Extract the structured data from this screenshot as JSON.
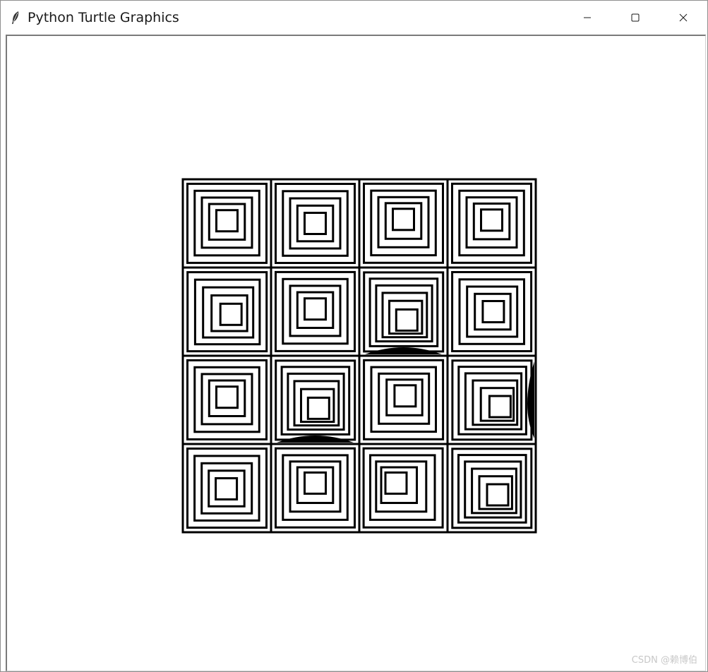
{
  "window": {
    "title": "Python Turtle Graphics",
    "app_icon": "feather-icon",
    "controls": {
      "minimize": "minimize-icon",
      "maximize": "maximize-icon",
      "close": "close-icon"
    }
  },
  "canvas": {
    "background": "#ffffff",
    "stroke_color": "#000000",
    "grid_rows": 4,
    "grid_cols": 4,
    "cells": [
      {
        "rings": 5,
        "dx": 0.0,
        "dy": -0.08,
        "fill_edge": ""
      },
      {
        "rings": 5,
        "dx": 0.0,
        "dy": 0.0,
        "fill_edge": ""
      },
      {
        "rings": 5,
        "dx": 0.0,
        "dy": -0.12,
        "fill_edge": ""
      },
      {
        "rings": 5,
        "dx": 0.0,
        "dy": -0.1,
        "fill_edge": ""
      },
      {
        "rings": 5,
        "dx": 0.12,
        "dy": 0.08,
        "fill_edge": ""
      },
      {
        "rings": 5,
        "dx": 0.0,
        "dy": -0.08,
        "fill_edge": ""
      },
      {
        "rings": 6,
        "dx": 0.1,
        "dy": 0.25,
        "fill_edge": "bottom"
      },
      {
        "rings": 5,
        "dx": 0.05,
        "dy": 0.0,
        "fill_edge": ""
      },
      {
        "rings": 5,
        "dx": 0.0,
        "dy": -0.08,
        "fill_edge": ""
      },
      {
        "rings": 6,
        "dx": 0.1,
        "dy": 0.25,
        "fill_edge": "bottom"
      },
      {
        "rings": 5,
        "dx": 0.05,
        "dy": -0.12,
        "fill_edge": ""
      },
      {
        "rings": 6,
        "dx": 0.25,
        "dy": 0.2,
        "fill_edge": "right"
      },
      {
        "rings": 5,
        "dx": -0.02,
        "dy": 0.02,
        "fill_edge": ""
      },
      {
        "rings": 5,
        "dx": 0.0,
        "dy": -0.15,
        "fill_edge": ""
      },
      {
        "rings": 5,
        "dx": -0.22,
        "dy": -0.15,
        "fill_edge": ""
      },
      {
        "rings": 6,
        "dx": 0.18,
        "dy": 0.2,
        "fill_edge": ""
      }
    ]
  },
  "watermark": "CSDN @赖博伯"
}
